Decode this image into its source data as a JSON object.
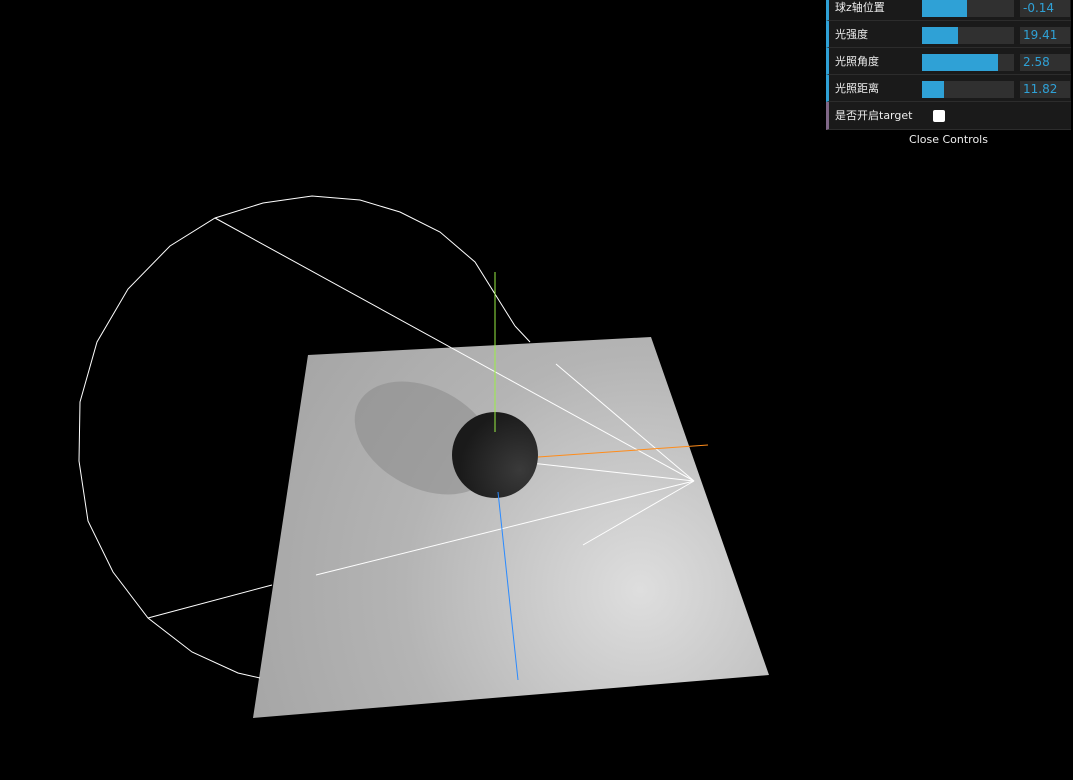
{
  "controls": [
    {
      "label": "球z轴位置",
      "value": "-0.14",
      "fill": 0.49
    },
    {
      "label": "光强度",
      "value": "19.41",
      "fill": 0.39
    },
    {
      "label": "光照角度",
      "value": "2.58",
      "fill": 0.83
    },
    {
      "label": "光照距离",
      "value": "11.82",
      "fill": 0.24
    }
  ],
  "toggle": {
    "label": "是否开启target",
    "checked": false
  },
  "close_label": "Close Controls",
  "colors": {
    "accent": "#2fa1d6",
    "x_axis": "#ff8c1a",
    "y_axis": "#99ee44",
    "z_axis": "#2a8aff"
  }
}
